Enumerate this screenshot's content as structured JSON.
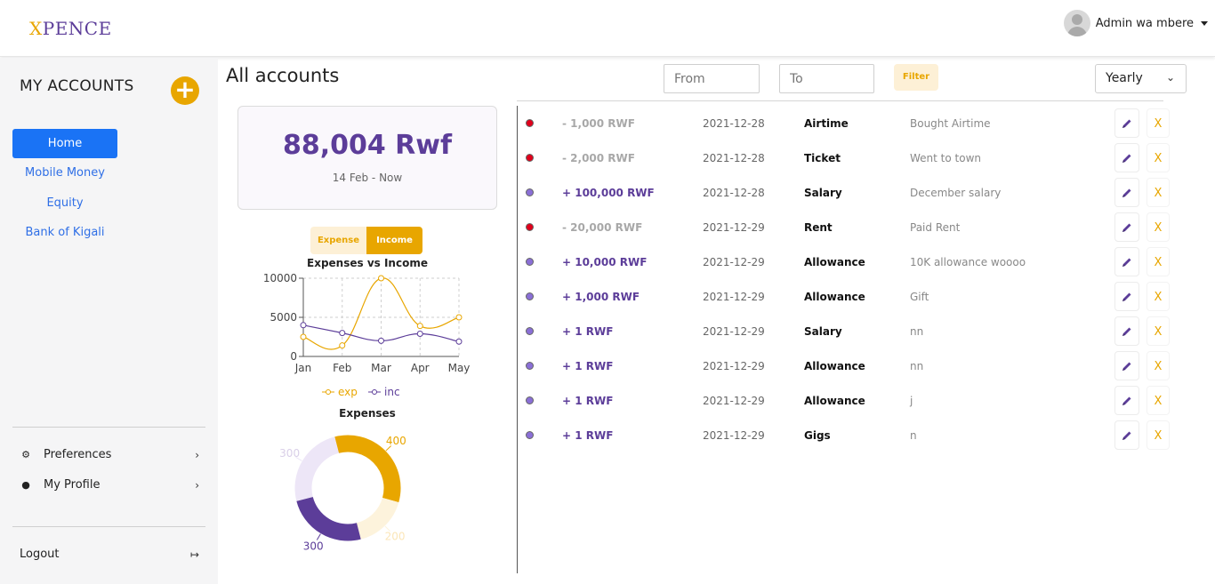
{
  "header": {
    "brand_first": "X",
    "brand_rest": "PENCE",
    "user_name": "Admin wa mbere"
  },
  "sidebar": {
    "title": "MY ACCOUNTS",
    "add_label": "+",
    "items": [
      {
        "label": "Home",
        "active": true
      },
      {
        "label": "Mobile Money",
        "active": false
      },
      {
        "label": "Equity",
        "active": false
      },
      {
        "label": "Bank of Kigali",
        "active": false
      }
    ],
    "preferences_label": "Preferences",
    "profile_label": "My Profile",
    "logout_label": "Logout"
  },
  "main": {
    "title": "All accounts",
    "from_placeholder": "From",
    "to_placeholder": "To",
    "filter_label": "Filter",
    "period_value": "Yearly"
  },
  "summary": {
    "amount": "88,004 Rwf",
    "period": "14 Feb - Now"
  },
  "toggle": {
    "expense_label": "Expense",
    "income_label": "Income",
    "selected": "Income"
  },
  "chart_data": [
    {
      "type": "line",
      "title": "Expenses vs Income",
      "x": [
        "Jan",
        "Feb",
        "Mar",
        "Apr",
        "May"
      ],
      "ylim": [
        0,
        10000
      ],
      "yticks": [
        0,
        5000,
        10000
      ],
      "grid": true,
      "legend": "bottom",
      "series": [
        {
          "name": "exp",
          "color": "#e8a600",
          "values": [
            2500,
            1400,
            10000,
            3900,
            5000
          ]
        },
        {
          "name": "inc",
          "color": "#5c3d99",
          "values": [
            4000,
            3000,
            2000,
            2900,
            1900
          ]
        }
      ]
    },
    {
      "type": "pie",
      "title": "Expenses",
      "labels": [
        "400",
        "200",
        "300",
        "300"
      ],
      "values": [
        400,
        200,
        300,
        300
      ],
      "colors": [
        "#e8a600",
        "#fdf3dc",
        "#5c3d99",
        "#ede6f7"
      ]
    }
  ],
  "transactions": [
    {
      "type": "expense",
      "amount": "- 1,000 RWF",
      "date": "2021-12-28",
      "category": "Airtime",
      "description": "Bought Airtime"
    },
    {
      "type": "expense",
      "amount": "- 2,000 RWF",
      "date": "2021-12-28",
      "category": "Ticket",
      "description": "Went to town"
    },
    {
      "type": "income",
      "amount": "+ 100,000 RWF",
      "date": "2021-12-28",
      "category": "Salary",
      "description": "December salary"
    },
    {
      "type": "expense",
      "amount": "- 20,000 RWF",
      "date": "2021-12-29",
      "category": "Rent",
      "description": "Paid Rent"
    },
    {
      "type": "income",
      "amount": "+ 10,000 RWF",
      "date": "2021-12-29",
      "category": "Allowance",
      "description": "10K allowance woooo"
    },
    {
      "type": "income",
      "amount": "+ 1,000 RWF",
      "date": "2021-12-29",
      "category": "Allowance",
      "description": "Gift"
    },
    {
      "type": "income",
      "amount": "+ 1 RWF",
      "date": "2021-12-29",
      "category": "Salary",
      "description": "nn"
    },
    {
      "type": "income",
      "amount": "+ 1 RWF",
      "date": "2021-12-29",
      "category": "Allowance",
      "description": "nn"
    },
    {
      "type": "income",
      "amount": "+ 1 RWF",
      "date": "2021-12-29",
      "category": "Allowance",
      "description": "j"
    },
    {
      "type": "income",
      "amount": "+ 1 RWF",
      "date": "2021-12-29",
      "category": "Gigs",
      "description": "n"
    }
  ],
  "delete_label": "X",
  "colors": {
    "accent": "#e8a600",
    "brand_purple": "#5c3d99",
    "active_blue": "#1a73f5",
    "expense_dot": "#e0001b",
    "income_dot": "#8a6fd6"
  }
}
